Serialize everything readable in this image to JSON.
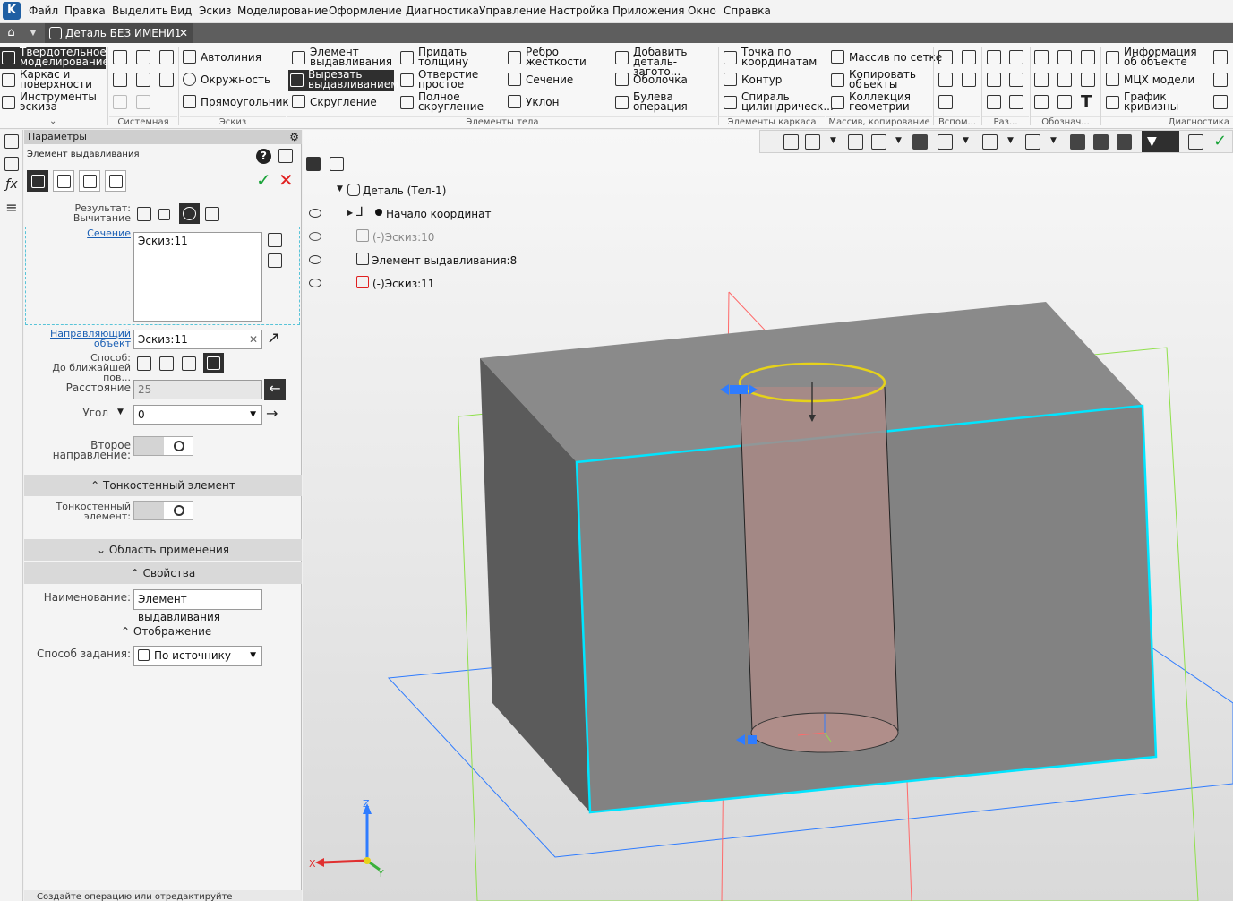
{
  "menu": {
    "logo": "K",
    "items": [
      "Файл",
      "Правка",
      "Выделить",
      "Вид",
      "Эскиз",
      "Моделирование",
      "Оформление",
      "Диагностика",
      "Управление",
      "Настройка",
      "Приложения",
      "Окно",
      "Справка"
    ]
  },
  "tabs": {
    "doc_title": "Деталь БЕЗ ИМЕНИ1",
    "close": "✕"
  },
  "ribbon": {
    "modes": [
      "Твердотельное моделирование",
      "Каркас и поверхности",
      "Инструменты эскиза"
    ],
    "sketch": [
      "Автолиния",
      "Окружность",
      "Прямоугольник"
    ],
    "body1": [
      "Элемент выдавливания",
      "Вырезать выдавливанием",
      "Скругление"
    ],
    "body2": [
      "Придать толщину",
      "Отверстие простое",
      "Полное скругление"
    ],
    "body3": [
      "Ребро жесткости",
      "Сечение",
      "Уклон"
    ],
    "body4": [
      "Добавить деталь-загото...",
      "Оболочка",
      "Булева операция"
    ],
    "frame": [
      "Точка по координатам",
      "Контур",
      "Спираль цилиндрическ..."
    ],
    "array": [
      "Массив по сетке",
      "Копировать объекты",
      "Коллекция геометрии"
    ],
    "diag": [
      "Информация об объекте",
      "МЦХ модели",
      "График кривизны"
    ],
    "groups": [
      "Системная",
      "Эскиз",
      "Элементы тела",
      "Элементы каркаса",
      "Массив, копирование",
      "Вспом...",
      "Раз...",
      "Обознач...",
      "Диагностика"
    ]
  },
  "panel": {
    "title": "Параметры",
    "subtitle": "Элемент выдавливания",
    "result_label": "Результат:",
    "result_value": "Вычитание",
    "section_link": "Сечение",
    "section_value": "Эскиз:11",
    "guide_link": "Направляющий объект",
    "guide_value": "Эскиз:11",
    "method_label": "Способ:",
    "method_value": "До ближайшей пов...",
    "distance_label": "Расстояние",
    "distance_value": "25",
    "angle_label": "Угол",
    "angle_value": "0",
    "second_dir": "Второе направление:",
    "thin_section": "Тонкостенный элемент",
    "thin_label": "Тонкостенный элемент:",
    "area_section": "Область применения",
    "props_section": "Свойства",
    "name_label": "Наименование:",
    "name_value": "Элемент выдавливания",
    "display_section": "Отображение",
    "mode_label": "Способ задания:",
    "mode_value": "По источнику",
    "toggle_symbol": "O",
    "status": "Создайте операцию или отредактируйте"
  },
  "tree": {
    "root": "Деталь (Тел-1)",
    "origin": "Начало координат",
    "sketch10": "Эскиз:10",
    "extrude8": "Элемент выдавливания:8",
    "sketch11": "Эскиз:11"
  },
  "axes": {
    "z": "Z",
    "x": "X",
    "y": "Y"
  },
  "colors": {
    "accent": "#2f2f2f",
    "edge_highlight": "#00e5ff",
    "sketch_yellow": "#e6d21a",
    "plane_blue": "#2f7cff",
    "plane_green": "#8fe04a",
    "plane_red": "#ff6a6a"
  }
}
